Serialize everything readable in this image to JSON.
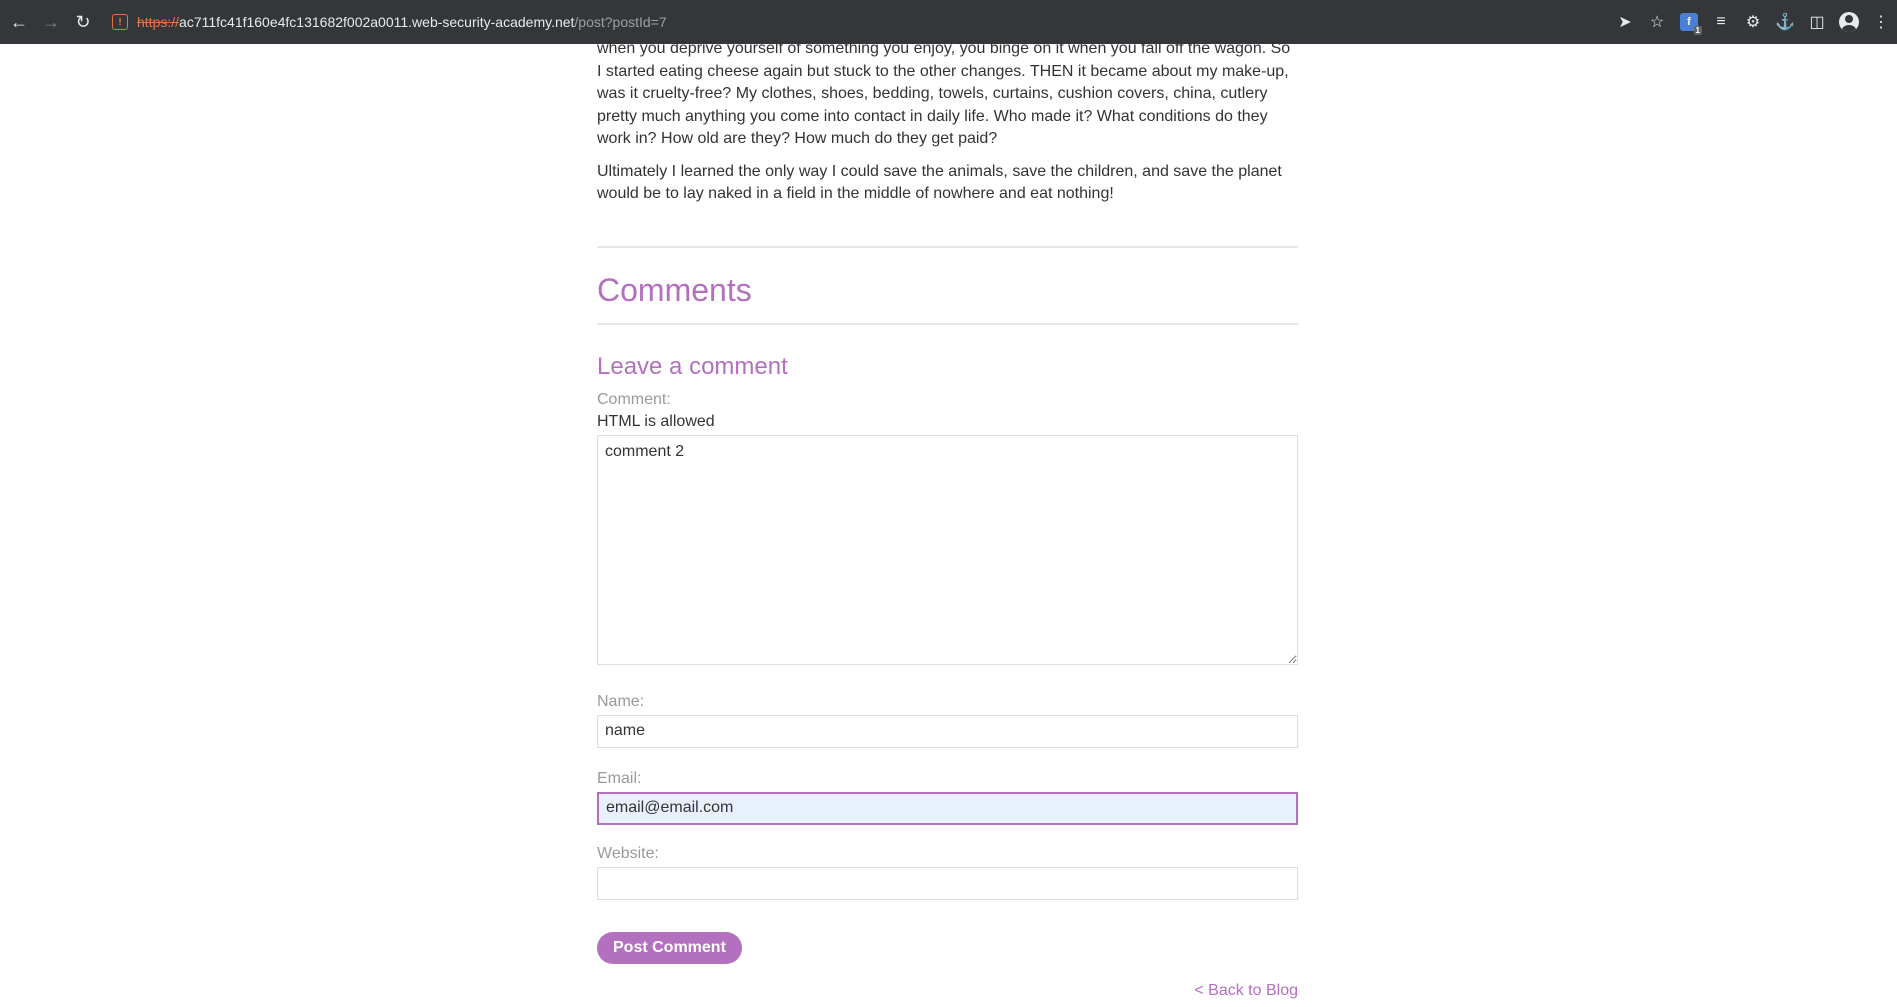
{
  "browser": {
    "url_scheme": "https://",
    "url_host": "ac711fc41f160e4fc131682f002a0011.web-security-academy.net",
    "url_path": "/post?postId=7",
    "extension_badge_letter": "f",
    "extension_badge_count": "1"
  },
  "article": {
    "paragraph_1_line_partial": "when you deprive yourself of something you enjoy, you binge on it when you fall off the wagon. So I started eating cheese again but stuck to the other changes. THEN it became about my make-up, was it cruelty-free? My clothes, shoes, bedding, towels, curtains, cushion covers, china, cutlery pretty much anything you come into contact in daily life. Who made it? What conditions do they work in? How old are they? How much do they get paid?",
    "paragraph_2": "Ultimately I learned the only way I could save the animals, save the children, and save the planet would be to lay naked in a field in the middle of nowhere and eat nothing!"
  },
  "comments": {
    "heading": "Comments",
    "form_heading": "Leave a comment",
    "comment_label": "Comment:",
    "html_note": "HTML is allowed",
    "comment_value": "comment 2",
    "name_label": "Name:",
    "name_value": "name",
    "email_label": "Email:",
    "email_value": "email@email.com",
    "website_label": "Website:",
    "website_value": "",
    "submit_label": "Post Comment",
    "back_link": "< Back to Blog"
  },
  "colors": {
    "accent": "#b370bf",
    "toolbar_bg": "#35363a",
    "insecure_scheme": "#e0744a"
  }
}
